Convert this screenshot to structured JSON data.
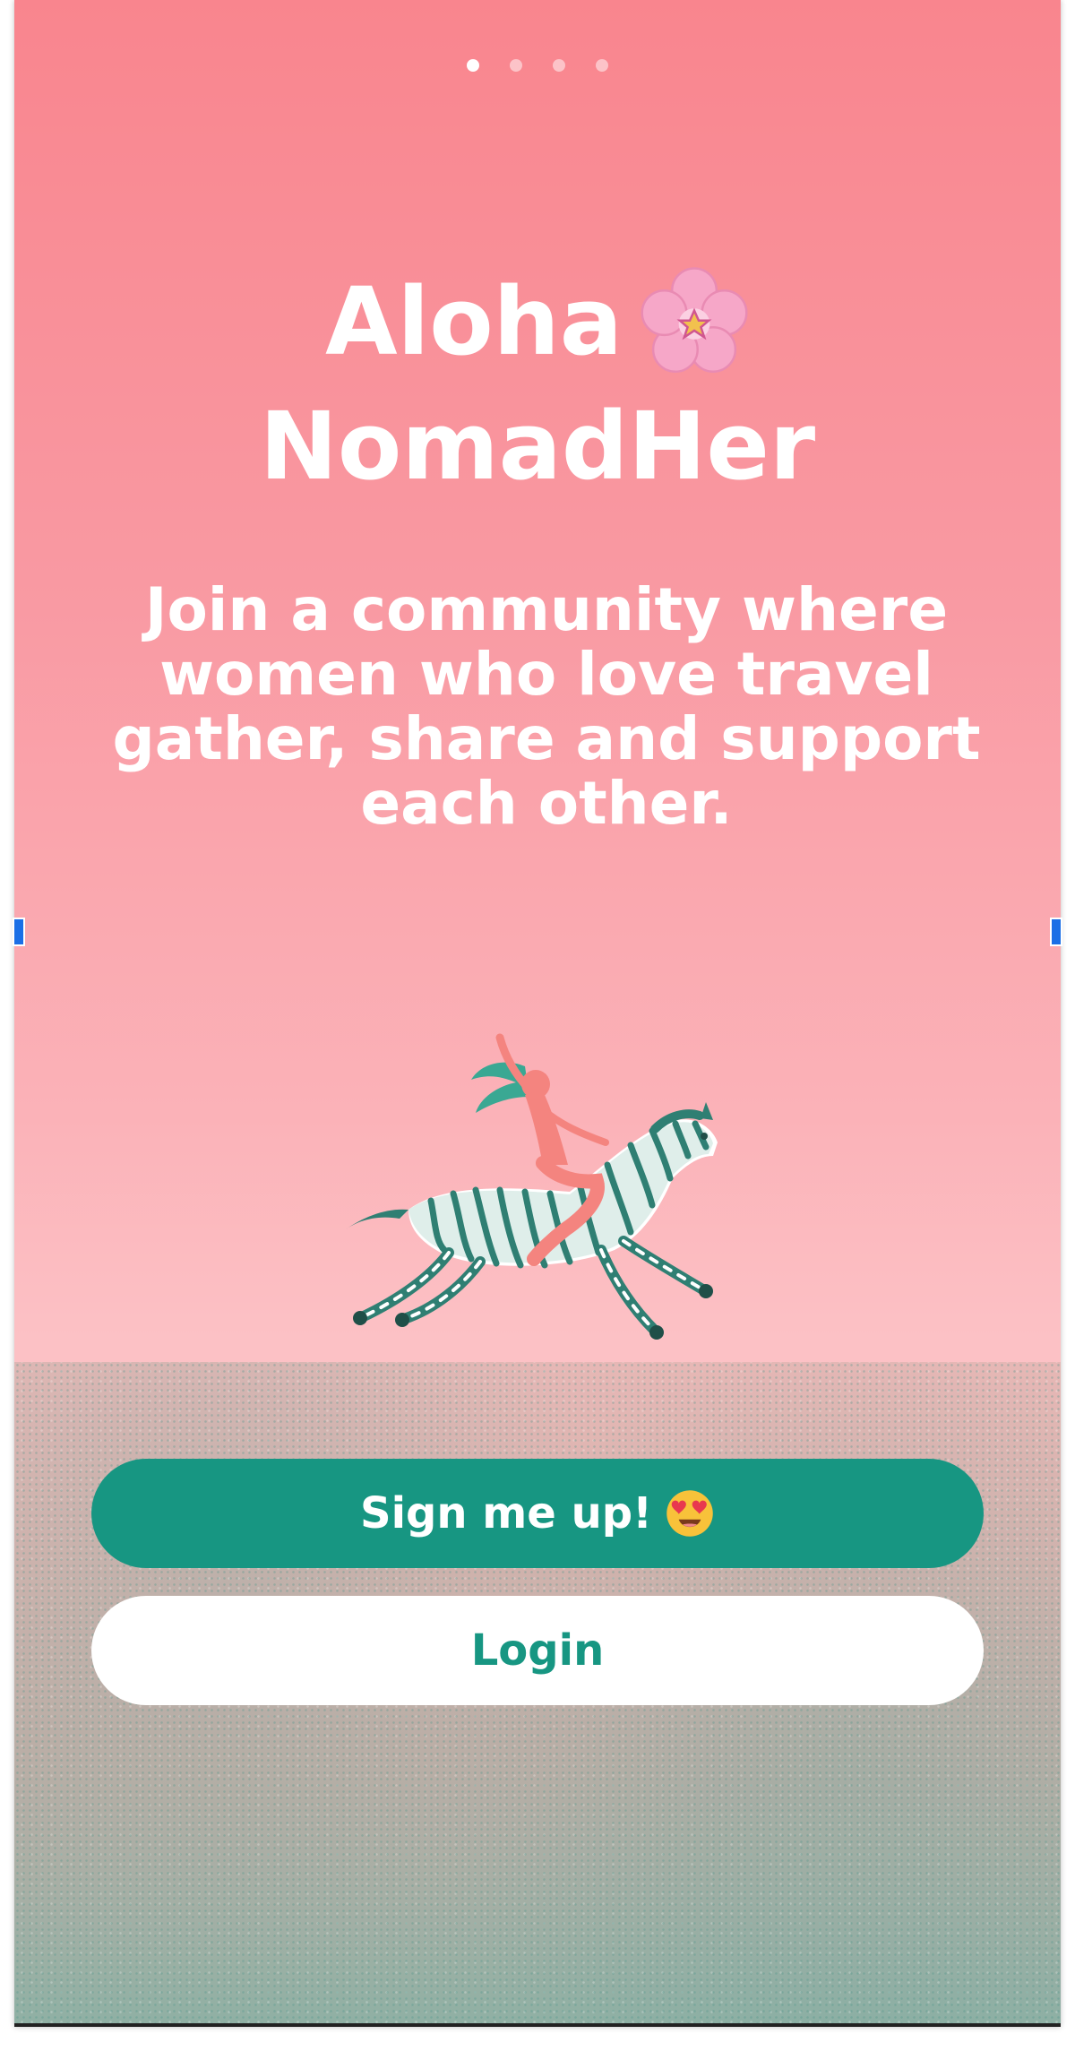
{
  "pager": {
    "total": 4,
    "active_index": 0
  },
  "header": {
    "title_line1": "Aloha",
    "title_line2": "NomadHer",
    "title_icon": "cherry-blossom-icon"
  },
  "intro": {
    "tagline": "Join a community where women who love travel gather, share and support each other."
  },
  "illustration": {
    "icon": "woman-riding-zebra-illustration"
  },
  "actions": {
    "signup_label": "Sign me up!",
    "signup_icon": "heart-eyes-emoji-icon",
    "login_label": "Login"
  },
  "colors": {
    "accent": "#179682",
    "background_top": "#f9858e",
    "background_bottom": "#fcc1c5",
    "text_on_background": "#ffffff"
  }
}
